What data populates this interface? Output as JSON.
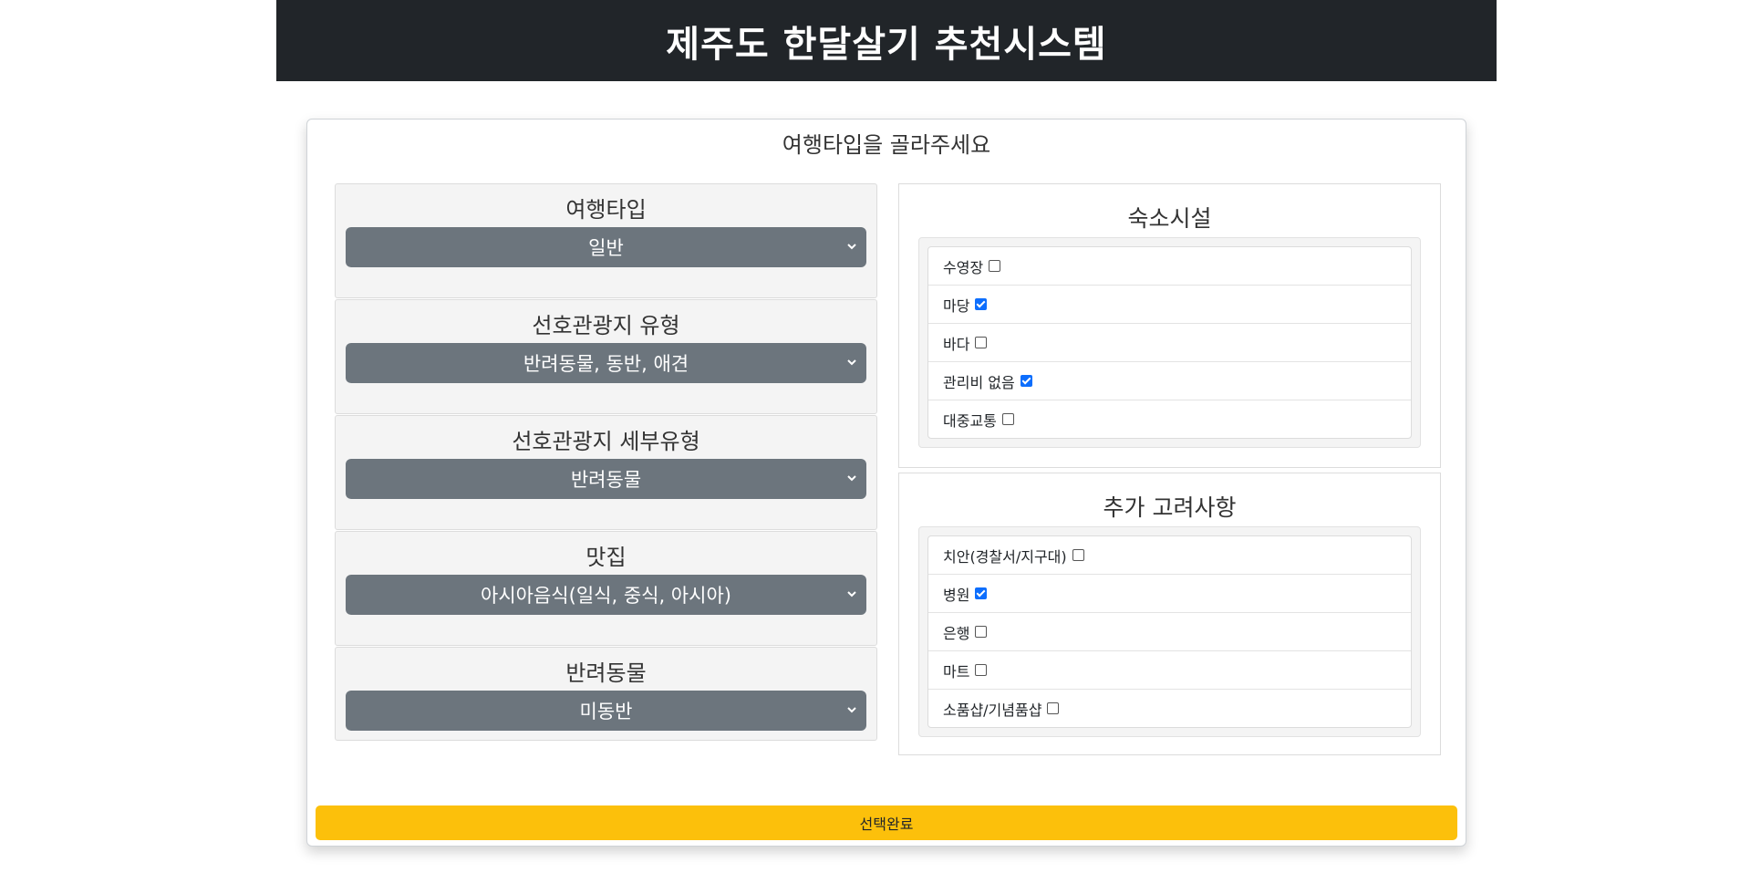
{
  "header": {
    "title": "제주도 한달살기 추천시스템"
  },
  "card": {
    "title": "여행타입을 골라주세요"
  },
  "selects": [
    {
      "label": "여행타입",
      "value": "일반"
    },
    {
      "label": "선호관광지 유형",
      "value": "반려동물, 동반, 애견"
    },
    {
      "label": "선호관광지 세부유형",
      "value": "반려동물"
    },
    {
      "label": "맛집",
      "value": "아시아음식(일식, 중식, 아시아)"
    },
    {
      "label": "반려동물",
      "value": "미동반"
    }
  ],
  "accommodation": {
    "title": "숙소시설",
    "items": [
      {
        "label": "수영장",
        "checked": false
      },
      {
        "label": "마당",
        "checked": true
      },
      {
        "label": "바다",
        "checked": false
      },
      {
        "label": "관리비 없음",
        "checked": true
      },
      {
        "label": "대중교통",
        "checked": false
      }
    ]
  },
  "extra": {
    "title": "추가 고려사항",
    "items": [
      {
        "label": "치안(경찰서/지구대)",
        "checked": false
      },
      {
        "label": "병원",
        "checked": true
      },
      {
        "label": "은행",
        "checked": false
      },
      {
        "label": "마트",
        "checked": false
      },
      {
        "label": "소품샵/기념품샵",
        "checked": false
      }
    ]
  },
  "submit": {
    "label": "선택완료"
  },
  "colors": {
    "header_bg": "#212529",
    "select_bg": "#6c757d",
    "submit_bg": "#fcc00b",
    "checkbox_checked": "#0d6efd"
  }
}
